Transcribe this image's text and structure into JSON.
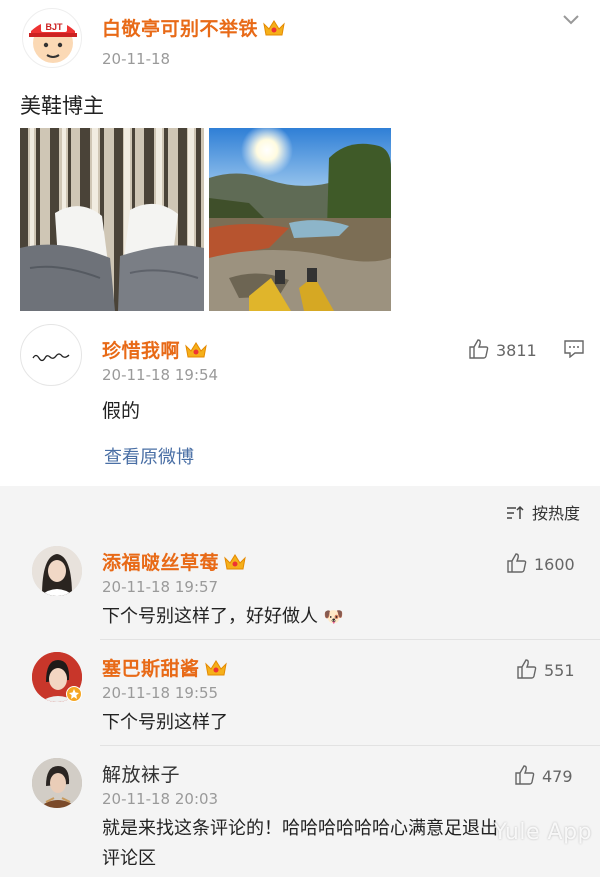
{
  "post": {
    "author": "白敬亭可别不举铁",
    "avatar_badge": "BJT",
    "time": "20-11-18",
    "text": "美鞋博主"
  },
  "main_comment": {
    "author": "珍惜我啊",
    "time": "20-11-18 19:54",
    "text": "假的",
    "likes": "3811",
    "view_original": "查看原微博"
  },
  "sort": {
    "label": "按热度"
  },
  "replies": [
    {
      "author": "添福啵丝草莓",
      "vip": true,
      "time": "20-11-18 19:57",
      "text": "下个号别这样了，好好做人",
      "emoji": "🐶",
      "likes": "1600"
    },
    {
      "author": "塞巴斯甜酱",
      "vip": true,
      "time": "20-11-18 19:55",
      "text": "下个号别这样了",
      "likes": "551"
    },
    {
      "author": "解放袜子",
      "vip": false,
      "time": "20-11-18 20:03",
      "text_line1": "就是来找这条评论的！哈哈哈哈哈哈心满意足退出",
      "text_line2": "评论区",
      "likes": "479"
    }
  ],
  "watermark": "Yule App",
  "colors": {
    "name_orange": "#e86a17",
    "link_blue": "#4a6fa5",
    "gray_bg": "#f4f4f4"
  }
}
